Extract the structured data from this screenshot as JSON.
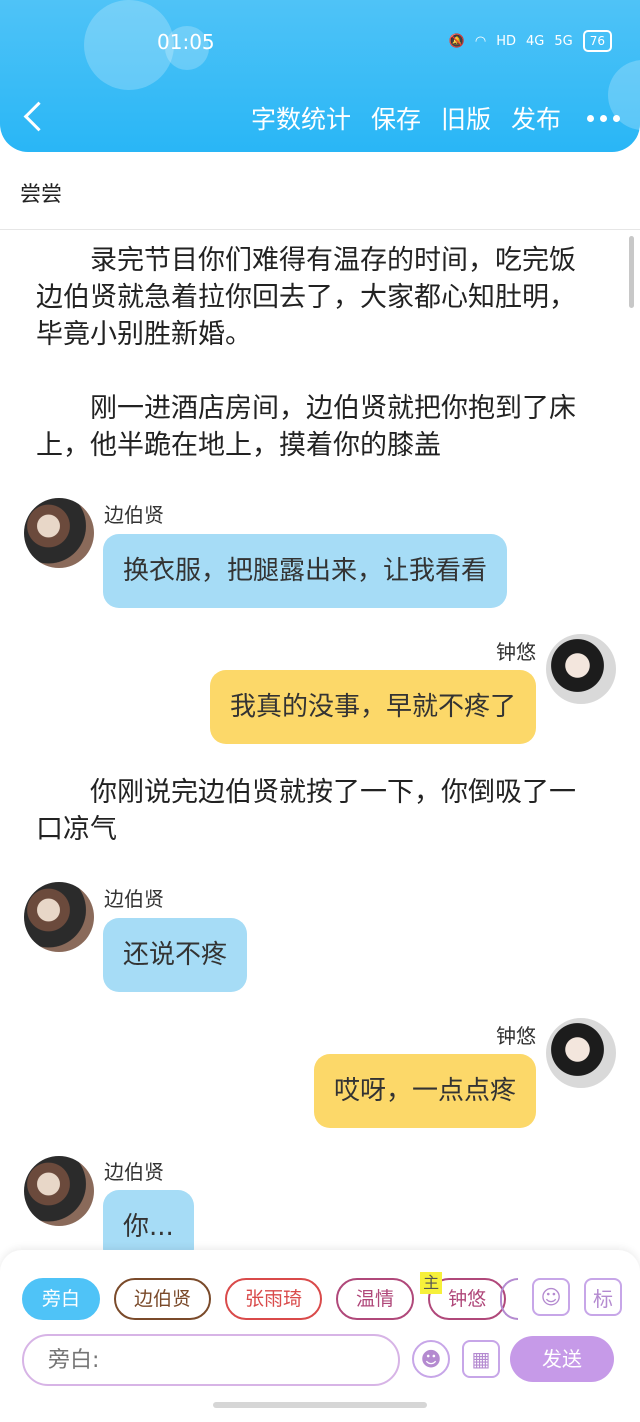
{
  "status_bar": {
    "time": "01:05",
    "hd": "HD",
    "network_4g": "4G",
    "network_5g": "5G",
    "battery": "76"
  },
  "toolbar": {
    "word_count": "字数统计",
    "save": "保存",
    "old_version": "旧版",
    "publish": "发布"
  },
  "doc": {
    "title": "尝尝"
  },
  "content": {
    "paragraphs": [
      "录完节目你们难得有温存的时间，吃完饭边伯贤就急着拉你回去了，大家都心知肚明，毕竟小别胜新婚。",
      "刚一进酒店房间，边伯贤就把你抱到了床上，他半跪在地上，摸着你的膝盖",
      "你刚说完边伯贤就按了一下，你倒吸了一口凉气"
    ],
    "messages": [
      {
        "sender": "边伯贤",
        "text": "换衣服，把腿露出来，让我看看"
      },
      {
        "sender": "钟悠",
        "text": "我真的没事，早就不疼了"
      },
      {
        "sender": "边伯贤",
        "text": "还说不疼"
      },
      {
        "sender": "钟悠",
        "text": "哎呀，一点点疼"
      },
      {
        "sender": "边伯贤",
        "text": "你..."
      }
    ]
  },
  "bottom": {
    "chips": [
      "旁白",
      "边伯贤",
      "张雨琦",
      "温情",
      "钟悠"
    ],
    "main_tag": "主",
    "icon_label": "标",
    "input_placeholder": "旁白:",
    "send": "发送"
  },
  "colors": {
    "header": "#29b6f6",
    "bubble_left": "#a6dcf6",
    "bubble_right": "#fcd869",
    "send": "#c69ae8"
  }
}
